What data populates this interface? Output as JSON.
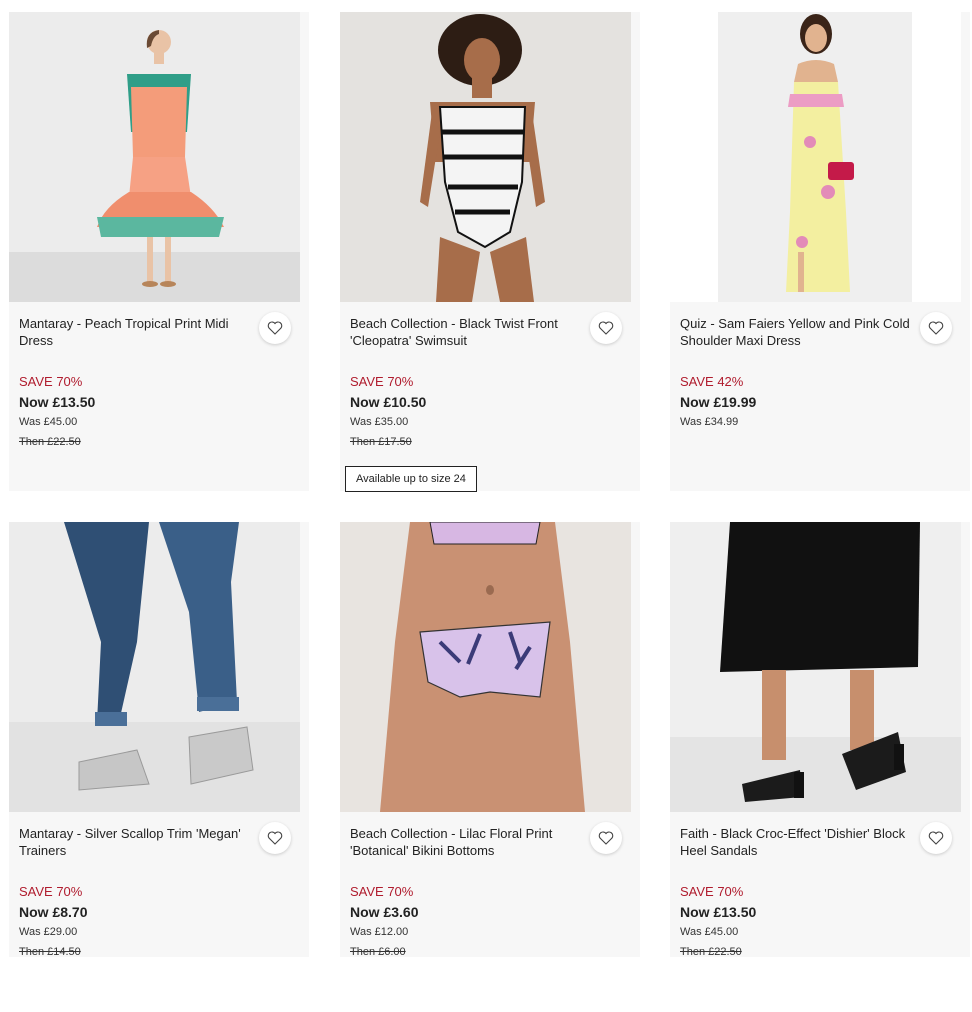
{
  "products": [
    {
      "name": "Mantaray - Peach Tropical Print Midi Dress",
      "save": "SAVE 70%",
      "now": "Now £13.50",
      "was": "Was £45.00",
      "then": "Then £22.50"
    },
    {
      "name": "Beach Collection - Black Twist Front 'Cleopatra' Swimsuit",
      "save": "SAVE 70%",
      "now": "Now £10.50",
      "was": "Was £35.00",
      "then": "Then £17.50",
      "badge": "Available up to size 24"
    },
    {
      "name": "Quiz - Sam Faiers Yellow and Pink Cold Shoulder Maxi Dress",
      "save": "SAVE 42%",
      "now": "Now £19.99",
      "was": "Was £34.99"
    },
    {
      "name": "Mantaray - Silver Scallop Trim 'Megan' Trainers",
      "save": "SAVE 70%",
      "now": "Now £8.70",
      "was": "Was £29.00",
      "then": "Then £14.50"
    },
    {
      "name": "Beach Collection - Lilac Floral Print 'Botanical' Bikini Bottoms",
      "save": "SAVE 70%",
      "now": "Now £3.60",
      "was": "Was £12.00",
      "then": "Then £6.00"
    },
    {
      "name": "Faith - Black Croc-Effect 'Dishier' Block Heel Sandals",
      "save": "SAVE 70%",
      "now": "Now £13.50",
      "was": "Was £45.00",
      "then": "Then £22.50"
    }
  ],
  "icons": {
    "wishlist": "heart-outline-icon"
  },
  "colors": {
    "save_red": "#b01c2e",
    "card_bg": "#f7f7f7"
  }
}
